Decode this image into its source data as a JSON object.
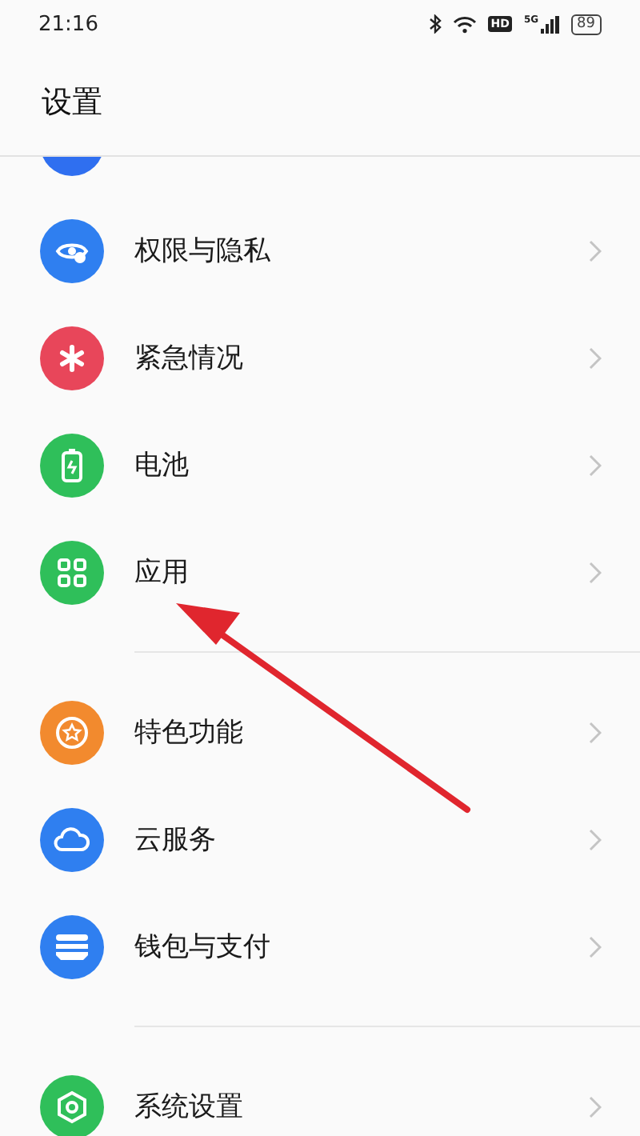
{
  "status_bar": {
    "time": "21:16",
    "hd": "HD",
    "network": "5G",
    "battery": "89"
  },
  "header": {
    "title": "设置"
  },
  "partial_item": {
    "color": "#2f6ff0"
  },
  "sections": [
    {
      "items": [
        {
          "label": "权限与隐私",
          "color": "#2f7ff0",
          "kind": "eye"
        },
        {
          "label": "紧急情况",
          "color": "#e8465a",
          "kind": "asterisk"
        },
        {
          "label": "电池",
          "color": "#2fbf5a",
          "kind": "battery"
        },
        {
          "label": "应用",
          "color": "#2fbf5a",
          "kind": "grid"
        }
      ]
    },
    {
      "items": [
        {
          "label": "特色功能",
          "color": "#f28a2e",
          "kind": "star"
        },
        {
          "label": "云服务",
          "color": "#2f7ff0",
          "kind": "cloud"
        },
        {
          "label": "钱包与支付",
          "color": "#2f7ff0",
          "kind": "wallet"
        }
      ]
    },
    {
      "items": [
        {
          "label": "系统设置",
          "color": "#2fbf5a",
          "kind": "hexagon"
        }
      ]
    }
  ],
  "annotation": {
    "kind": "arrow",
    "color": "#e0262e"
  }
}
